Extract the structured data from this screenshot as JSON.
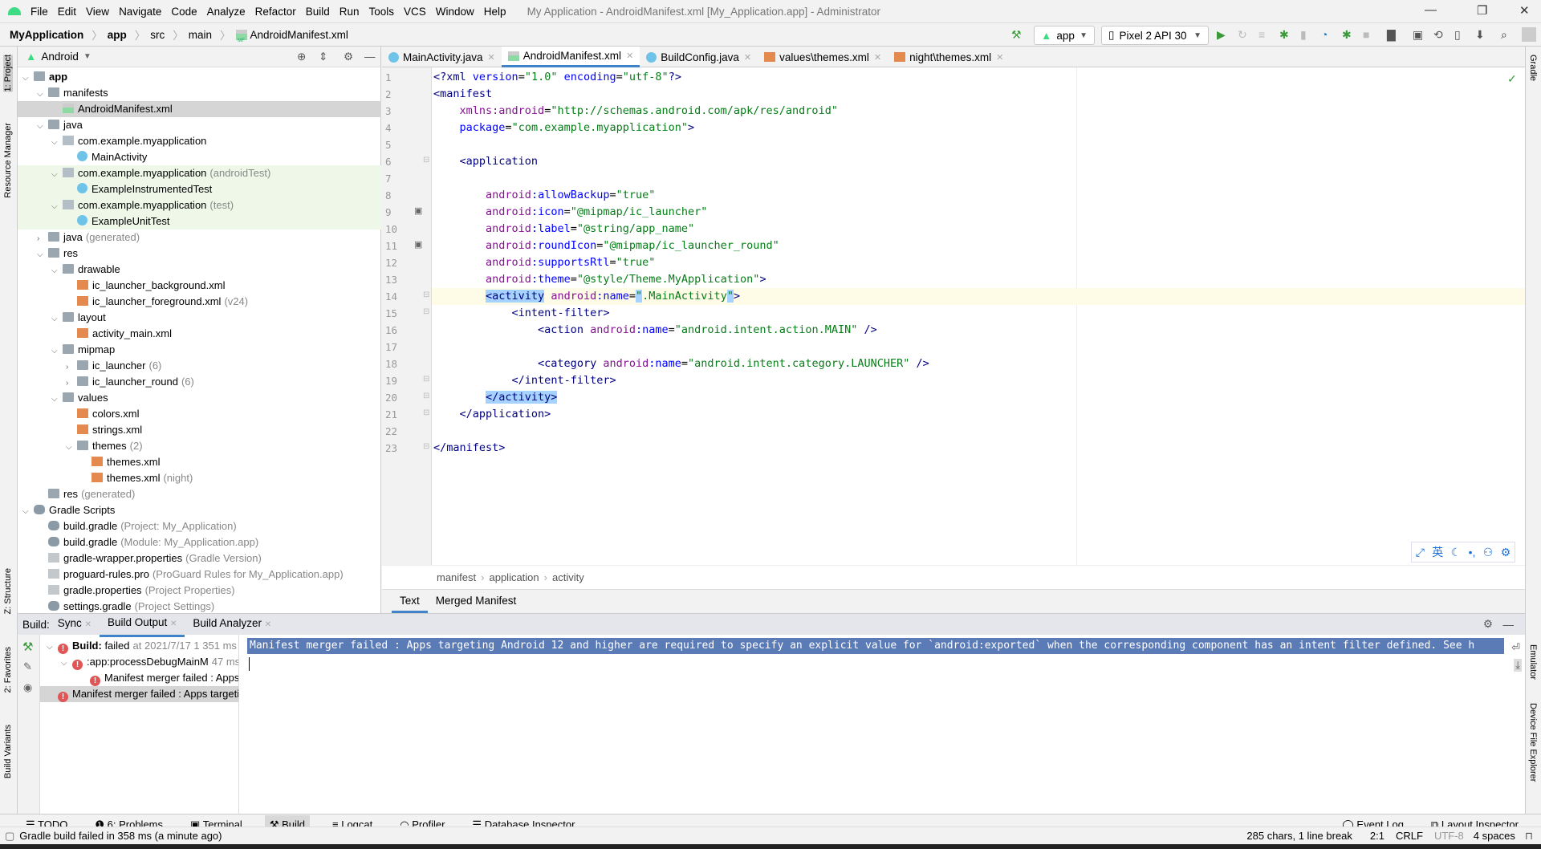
{
  "menu": {
    "items": [
      "File",
      "Edit",
      "View",
      "Navigate",
      "Code",
      "Analyze",
      "Refactor",
      "Build",
      "Run",
      "Tools",
      "VCS",
      "Window",
      "Help"
    ],
    "window_title": "My Application - AndroidManifest.xml [My_Application.app] - Administrator"
  },
  "breadcrumb": [
    "MyApplication",
    "app",
    "src",
    "main",
    "AndroidManifest.xml"
  ],
  "toolbar": {
    "config": "app",
    "device": "Pixel 2 API 30"
  },
  "left_strip": {
    "project": "1: Project",
    "resource_manager": "Resource Manager",
    "structure": "Z: Structure",
    "favorites": "2: Favorites",
    "build_variants": "Build Variants"
  },
  "right_strip": {
    "gradle": "Gradle",
    "emulator": "Emulator",
    "device_file_explorer": "Device File Explorer"
  },
  "project": {
    "view": "Android",
    "tree": [
      {
        "d": 0,
        "open": true,
        "icon": "folder",
        "label": "app",
        "bold": true
      },
      {
        "d": 1,
        "open": true,
        "icon": "folder",
        "label": "manifests"
      },
      {
        "d": 2,
        "icon": "mf",
        "label": "AndroidManifest.xml",
        "sel": true
      },
      {
        "d": 1,
        "open": true,
        "icon": "folder",
        "label": "java"
      },
      {
        "d": 2,
        "open": true,
        "icon": "pkg",
        "label": "com.example.myapplication"
      },
      {
        "d": 3,
        "icon": "cls",
        "label": "MainActivity"
      },
      {
        "d": 2,
        "open": true,
        "icon": "pkg",
        "label": "com.example.myapplication",
        "suffix": "(androidTest)",
        "test": true
      },
      {
        "d": 3,
        "icon": "cls",
        "label": "ExampleInstrumentedTest",
        "test": true
      },
      {
        "d": 2,
        "open": true,
        "icon": "pkg",
        "label": "com.example.myapplication",
        "suffix": "(test)",
        "test": true
      },
      {
        "d": 3,
        "icon": "cls",
        "label": "ExampleUnitTest",
        "test": true
      },
      {
        "d": 1,
        "open": false,
        "icon": "folder",
        "label": "java",
        "suffix": "(generated)"
      },
      {
        "d": 1,
        "open": true,
        "icon": "folder",
        "label": "res"
      },
      {
        "d": 2,
        "open": true,
        "icon": "folder",
        "label": "drawable"
      },
      {
        "d": 3,
        "icon": "xml",
        "label": "ic_launcher_background.xml"
      },
      {
        "d": 3,
        "icon": "xml",
        "label": "ic_launcher_foreground.xml",
        "suffix": "(v24)"
      },
      {
        "d": 2,
        "open": true,
        "icon": "folder",
        "label": "layout"
      },
      {
        "d": 3,
        "icon": "xml",
        "label": "activity_main.xml"
      },
      {
        "d": 2,
        "open": true,
        "icon": "folder",
        "label": "mipmap"
      },
      {
        "d": 3,
        "open": false,
        "icon": "folder",
        "label": "ic_launcher",
        "suffix": "(6)"
      },
      {
        "d": 3,
        "open": false,
        "icon": "folder",
        "label": "ic_launcher_round",
        "suffix": "(6)"
      },
      {
        "d": 2,
        "open": true,
        "icon": "folder",
        "label": "values"
      },
      {
        "d": 3,
        "icon": "xml",
        "label": "colors.xml"
      },
      {
        "d": 3,
        "icon": "xml",
        "label": "strings.xml"
      },
      {
        "d": 3,
        "open": true,
        "icon": "folder",
        "label": "themes",
        "suffix": "(2)"
      },
      {
        "d": 4,
        "icon": "xml",
        "label": "themes.xml"
      },
      {
        "d": 4,
        "icon": "xml",
        "label": "themes.xml",
        "suffix": "(night)"
      },
      {
        "d": 1,
        "icon": "folder",
        "label": "res",
        "suffix": "(generated)"
      },
      {
        "d": 0,
        "open": true,
        "icon": "gradle",
        "label": "Gradle Scripts"
      },
      {
        "d": 1,
        "icon": "gradle",
        "label": "build.gradle",
        "suffix": "(Project: My_Application)"
      },
      {
        "d": 1,
        "icon": "gradle",
        "label": "build.gradle",
        "suffix": "(Module: My_Application.app)"
      },
      {
        "d": 1,
        "icon": "file",
        "label": "gradle-wrapper.properties",
        "suffix": "(Gradle Version)"
      },
      {
        "d": 1,
        "icon": "file",
        "label": "proguard-rules.pro",
        "suffix": "(ProGuard Rules for My_Application.app)"
      },
      {
        "d": 1,
        "icon": "file",
        "label": "gradle.properties",
        "suffix": "(Project Properties)"
      },
      {
        "d": 1,
        "icon": "gradle",
        "label": "settings.gradle",
        "suffix": "(Project Settings)"
      }
    ]
  },
  "editor": {
    "tabs": [
      {
        "label": "MainActivity.java",
        "icon": "cls"
      },
      {
        "label": "AndroidManifest.xml",
        "icon": "mf",
        "active": true
      },
      {
        "label": "BuildConfig.java",
        "icon": "cls"
      },
      {
        "label": "values\\themes.xml",
        "icon": "xml"
      },
      {
        "label": "night\\themes.xml",
        "icon": "xml"
      }
    ],
    "current_line": 14,
    "lines": [
      [
        [
          "t",
          "<?xml "
        ],
        [
          "b",
          "version"
        ],
        [
          "p",
          "="
        ],
        [
          "v",
          "\"1.0\""
        ],
        [
          "p",
          " "
        ],
        [
          "b",
          "encoding"
        ],
        [
          "p",
          "="
        ],
        [
          "v",
          "\"utf-8\""
        ],
        [
          "t",
          "?>"
        ]
      ],
      [
        [
          "t",
          "<manifest"
        ]
      ],
      [
        [
          "p",
          "    "
        ],
        [
          "a",
          "xmlns:android"
        ],
        [
          "p",
          "="
        ],
        [
          "v",
          "\"http://schemas.android.com/apk/res/android\""
        ]
      ],
      [
        [
          "p",
          "    "
        ],
        [
          "b",
          "package"
        ],
        [
          "p",
          "="
        ],
        [
          "v",
          "\"com.example.myapplication\""
        ],
        [
          "t",
          ">"
        ]
      ],
      [],
      [
        [
          "p",
          "    "
        ],
        [
          "t",
          "<application"
        ]
      ],
      [],
      [
        [
          "p",
          "        "
        ],
        [
          "a",
          "android"
        ],
        [
          "b",
          ":allowBackup"
        ],
        [
          "p",
          "="
        ],
        [
          "v",
          "\"true\""
        ]
      ],
      [
        [
          "p",
          "        "
        ],
        [
          "a",
          "android"
        ],
        [
          "b",
          ":icon"
        ],
        [
          "p",
          "="
        ],
        [
          "v",
          "\"@mipmap/ic_launcher\""
        ]
      ],
      [
        [
          "p",
          "        "
        ],
        [
          "a",
          "android"
        ],
        [
          "b",
          ":label"
        ],
        [
          "p",
          "="
        ],
        [
          "v",
          "\"@string/app_name\""
        ]
      ],
      [
        [
          "p",
          "        "
        ],
        [
          "a",
          "android"
        ],
        [
          "b",
          ":roundIcon"
        ],
        [
          "p",
          "="
        ],
        [
          "v",
          "\"@mipmap/ic_launcher_round\""
        ]
      ],
      [
        [
          "p",
          "        "
        ],
        [
          "a",
          "android"
        ],
        [
          "b",
          ":supportsRtl"
        ],
        [
          "p",
          "="
        ],
        [
          "v",
          "\"true\""
        ]
      ],
      [
        [
          "p",
          "        "
        ],
        [
          "a",
          "android"
        ],
        [
          "b",
          ":theme"
        ],
        [
          "p",
          "="
        ],
        [
          "v",
          "\"@style/Theme.MyApplication\""
        ],
        [
          "t",
          ">"
        ]
      ],
      [
        [
          "p",
          "        "
        ],
        [
          "th",
          "<activity"
        ],
        [
          "p",
          " "
        ],
        [
          "a",
          "android"
        ],
        [
          "b",
          ":name"
        ],
        [
          "p",
          "="
        ],
        [
          "vh",
          "\""
        ],
        [
          "v",
          ".MainActivity"
        ],
        [
          "vh",
          "\""
        ],
        [
          "t",
          ">"
        ]
      ],
      [
        [
          "p",
          "            "
        ],
        [
          "t",
          "<intent-filter>"
        ]
      ],
      [
        [
          "p",
          "                "
        ],
        [
          "t",
          "<action "
        ],
        [
          "a",
          "android"
        ],
        [
          "b",
          ":name"
        ],
        [
          "p",
          "="
        ],
        [
          "v",
          "\"android.intent.action.MAIN\""
        ],
        [
          "t",
          " />"
        ]
      ],
      [],
      [
        [
          "p",
          "                "
        ],
        [
          "t",
          "<category "
        ],
        [
          "a",
          "android"
        ],
        [
          "b",
          ":name"
        ],
        [
          "p",
          "="
        ],
        [
          "v",
          "\"android.intent.category.LAUNCHER\""
        ],
        [
          "t",
          " />"
        ]
      ],
      [
        [
          "p",
          "            "
        ],
        [
          "t",
          "</intent-filter>"
        ]
      ],
      [
        [
          "p",
          "        "
        ],
        [
          "th",
          "</activity>"
        ]
      ],
      [
        [
          "p",
          "    "
        ],
        [
          "t",
          "</application>"
        ]
      ],
      [],
      [
        [
          "t",
          "</manifest>"
        ]
      ]
    ],
    "breadcrumb": [
      "manifest",
      "application",
      "activity"
    ],
    "bottom_tabs": {
      "text": "Text",
      "merged": "Merged Manifest"
    }
  },
  "ime": {
    "lang": "英"
  },
  "build": {
    "label": "Build:",
    "tabs": [
      "Sync",
      "Build Output",
      "Build Analyzer"
    ],
    "tree": [
      {
        "d": 0,
        "bold": "Build:",
        "label": " failed",
        "suffix": "at 2021/7/17 1 351 ms"
      },
      {
        "d": 1,
        "label": ":app:processDebugMainM",
        "suffix": "47 ms"
      },
      {
        "d": 2,
        "label": "Manifest merger failed : Apps targeting"
      },
      {
        "d": 1,
        "label": "Manifest merger failed : Apps targeting",
        "sel": true
      }
    ],
    "output": "Manifest merger failed : Apps targeting Android 12 and higher are required to specify an explicit value for `android:exported` when the corresponding component has an intent filter defined. See h"
  },
  "bottom_tools": [
    "TODO",
    "6: Problems",
    "Terminal",
    "Build",
    "Logcat",
    "Profiler",
    "Database Inspector"
  ],
  "bottom_tools_right": [
    "Event Log",
    "Layout Inspector"
  ],
  "status": {
    "message": "Gradle build failed in 358 ms (a minute ago)",
    "chars": "285 chars, 1 line break",
    "position": "2:1",
    "line_sep": "CRLF",
    "encoding": "UTF-8",
    "indent": "4 spaces"
  }
}
